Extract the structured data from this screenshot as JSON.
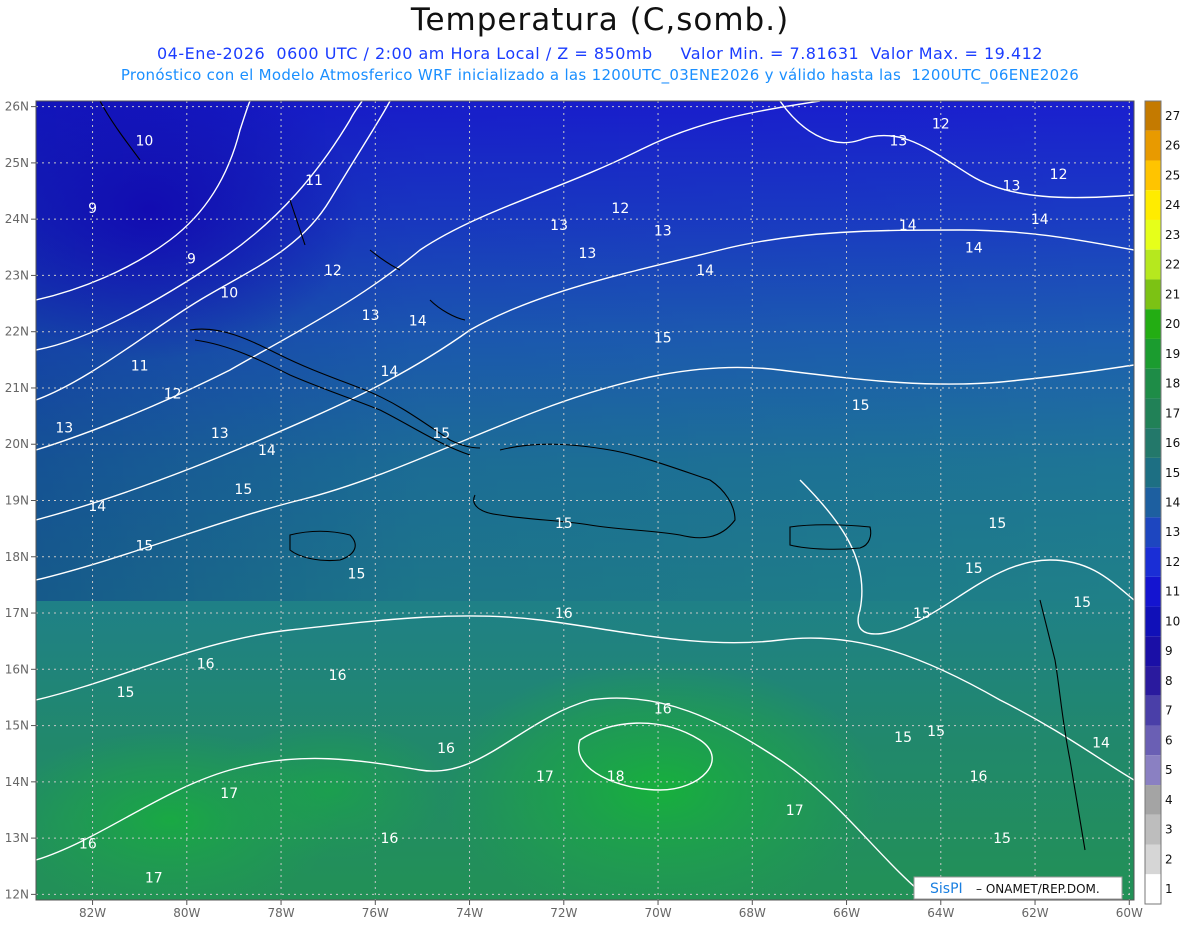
{
  "title": "Temperatura (C,somb.)",
  "subtitle": {
    "line1": "04-Ene-2026  0600 UTC / 2:00 am Hora Local / Z = 850mb",
    "min_label": "Valor Min. = 7.81631",
    "max_label": "Valor Max. = 19.412",
    "line2": "Pronóstico con el Modelo Atmosferico WRF inicializado a las 1200UTC_03ENE2026 y válido hasta las  1200UTC_06ENE2026"
  },
  "axes": {
    "lon_labels": [
      "82W",
      "80W",
      "78W",
      "76W",
      "74W",
      "72W",
      "70W",
      "68W",
      "66W",
      "64W",
      "62W",
      "60W"
    ],
    "lat_labels": [
      "26N",
      "25N",
      "24N",
      "23N",
      "22N",
      "21N",
      "20N",
      "19N",
      "18N",
      "17N",
      "16N",
      "15N",
      "14N",
      "13N",
      "12N"
    ]
  },
  "colorbar": {
    "labels": [
      "27",
      "26",
      "25",
      "24",
      "23",
      "22",
      "21",
      "20",
      "19",
      "18",
      "17",
      "16",
      "15",
      "14",
      "13",
      "12",
      "11",
      "10",
      "9",
      "8",
      "7",
      "6",
      "5",
      "4",
      "3",
      "2",
      "1"
    ],
    "colors": [
      "#c47a00",
      "#e89a00",
      "#ffc400",
      "#ffec00",
      "#e6ff1a",
      "#b6e81e",
      "#7cc214",
      "#23ad13",
      "#1b9c2f",
      "#1e8c47",
      "#218157",
      "#23786a",
      "#1d6f83",
      "#1d5fa0",
      "#1d46c0",
      "#1a2ed6",
      "#1414d0",
      "#1010b8",
      "#1a0fa6",
      "#2a1a9e",
      "#4a3fa8",
      "#6a5fb4",
      "#8a80c2",
      "#a4a4a4",
      "#bdbdbd",
      "#d6d6d6",
      "#ffffff"
    ]
  },
  "contour_labels": [
    {
      "v": "10",
      "lon": -80.9,
      "lat": 25.4
    },
    {
      "v": "9",
      "lon": -82.0,
      "lat": 24.2
    },
    {
      "v": "9",
      "lon": -79.9,
      "lat": 23.3
    },
    {
      "v": "10",
      "lon": -79.1,
      "lat": 22.7
    },
    {
      "v": "11",
      "lon": -77.3,
      "lat": 24.7
    },
    {
      "v": "12",
      "lon": -76.9,
      "lat": 23.1
    },
    {
      "v": "13",
      "lon": -76.1,
      "lat": 22.3
    },
    {
      "v": "11",
      "lon": -81.0,
      "lat": 21.4
    },
    {
      "v": "12",
      "lon": -80.3,
      "lat": 20.9
    },
    {
      "v": "13",
      "lon": -82.6,
      "lat": 20.3
    },
    {
      "v": "13",
      "lon": -79.3,
      "lat": 20.2
    },
    {
      "v": "14",
      "lon": -78.3,
      "lat": 19.9
    },
    {
      "v": "14",
      "lon": -75.1,
      "lat": 22.2
    },
    {
      "v": "14",
      "lon": -75.7,
      "lat": 21.3
    },
    {
      "v": "15",
      "lon": -74.6,
      "lat": 20.2
    },
    {
      "v": "13",
      "lon": -72.1,
      "lat": 23.9
    },
    {
      "v": "13",
      "lon": -71.5,
      "lat": 23.4
    },
    {
      "v": "12",
      "lon": -70.8,
      "lat": 24.2
    },
    {
      "v": "13",
      "lon": -69.9,
      "lat": 23.8
    },
    {
      "v": "14",
      "lon": -69.0,
      "lat": 23.1
    },
    {
      "v": "15",
      "lon": -69.9,
      "lat": 21.9
    },
    {
      "v": "13",
      "lon": -64.9,
      "lat": 25.4
    },
    {
      "v": "12",
      "lon": -64.0,
      "lat": 25.7
    },
    {
      "v": "13",
      "lon": -62.5,
      "lat": 24.6
    },
    {
      "v": "12",
      "lon": -61.5,
      "lat": 24.8
    },
    {
      "v": "14",
      "lon": -64.7,
      "lat": 23.9
    },
    {
      "v": "14",
      "lon": -61.9,
      "lat": 24.0
    },
    {
      "v": "14",
      "lon": -63.3,
      "lat": 23.5
    },
    {
      "v": "15",
      "lon": -65.7,
      "lat": 20.7
    },
    {
      "v": "15",
      "lon": -78.8,
      "lat": 19.2
    },
    {
      "v": "14",
      "lon": -81.9,
      "lat": 18.9
    },
    {
      "v": "15",
      "lon": -80.9,
      "lat": 18.2
    },
    {
      "v": "15",
      "lon": -76.4,
      "lat": 17.7
    },
    {
      "v": "15",
      "lon": -72.0,
      "lat": 18.6
    },
    {
      "v": "15",
      "lon": -62.8,
      "lat": 18.6
    },
    {
      "v": "15",
      "lon": -63.3,
      "lat": 17.8
    },
    {
      "v": "15",
      "lon": -61.0,
      "lat": 17.2
    },
    {
      "v": "15",
      "lon": -64.4,
      "lat": 17.0
    },
    {
      "v": "16",
      "lon": -72.0,
      "lat": 17.0
    },
    {
      "v": "16",
      "lon": -79.6,
      "lat": 16.1
    },
    {
      "v": "16",
      "lon": -76.8,
      "lat": 15.9
    },
    {
      "v": "16",
      "lon": -69.9,
      "lat": 15.3
    },
    {
      "v": "15",
      "lon": -81.3,
      "lat": 15.6
    },
    {
      "v": "15",
      "lon": -64.8,
      "lat": 14.8
    },
    {
      "v": "15",
      "lon": -64.1,
      "lat": 14.9
    },
    {
      "v": "16",
      "lon": -74.5,
      "lat": 14.6
    },
    {
      "v": "16",
      "lon": -63.2,
      "lat": 14.1
    },
    {
      "v": "14",
      "lon": -60.6,
      "lat": 14.7
    },
    {
      "v": "17",
      "lon": -72.4,
      "lat": 14.1
    },
    {
      "v": "18",
      "lon": -70.9,
      "lat": 14.1
    },
    {
      "v": "17",
      "lon": -79.1,
      "lat": 13.8
    },
    {
      "v": "17",
      "lon": -67.1,
      "lat": 13.5
    },
    {
      "v": "16",
      "lon": -75.7,
      "lat": 13.0
    },
    {
      "v": "16",
      "lon": -82.1,
      "lat": 12.9
    },
    {
      "v": "17",
      "lon": -80.7,
      "lat": 12.3
    },
    {
      "v": "15",
      "lon": -62.7,
      "lat": 13.0
    }
  ],
  "watermark": {
    "logo": "SisPI",
    "text": "– ONAMET/REP.DOM."
  }
}
